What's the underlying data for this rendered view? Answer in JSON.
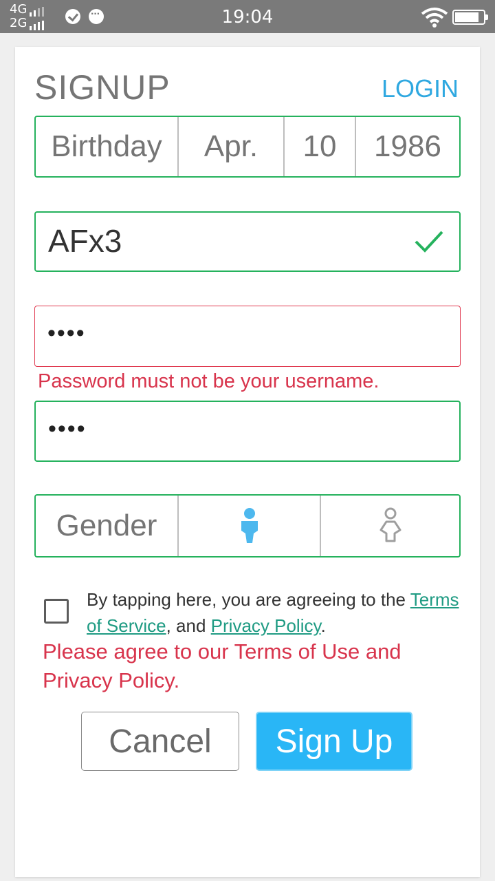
{
  "status_bar": {
    "net_top": "4G",
    "net_bottom": "2G",
    "time": "19:04",
    "icons": [
      "signal-icon",
      "check-circle-icon",
      "chat-icon",
      "wifi-icon",
      "battery-icon"
    ]
  },
  "header": {
    "title": "SIGNUP",
    "login_link": "LOGIN"
  },
  "birthday": {
    "label": "Birthday",
    "month": "Apr.",
    "day": "10",
    "year": "1986"
  },
  "username": {
    "value": "AFx3"
  },
  "password": {
    "value_masked": "••••",
    "error": "Password must not be your username."
  },
  "confirm_password": {
    "value_masked": "••••"
  },
  "gender": {
    "label": "Gender",
    "options": [
      "male-icon",
      "female-icon"
    ],
    "selected": "male-icon"
  },
  "agreement": {
    "text_before": "By tapping here, you are agreeing to the ",
    "terms_link": "Terms of Service",
    "text_middle": ", and ",
    "privacy_link": "Privacy Policy",
    "text_after": ".",
    "error": "Please agree to our Terms of Use and Privacy Policy."
  },
  "buttons": {
    "cancel": "Cancel",
    "sign_up": "Sign Up"
  },
  "colors": {
    "valid_border": "#25b25d",
    "error": "#d8344c",
    "accent": "#29b6f6",
    "link": "#1f9b83"
  }
}
